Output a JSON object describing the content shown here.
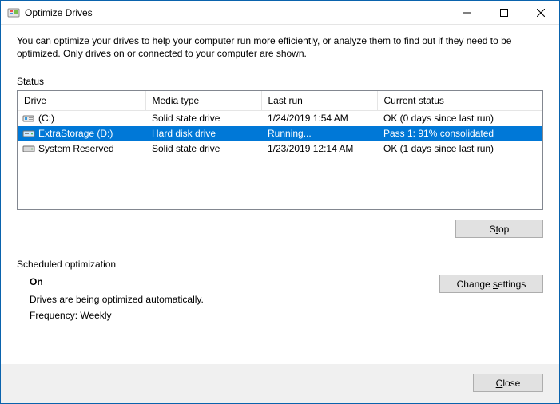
{
  "window": {
    "title": "Optimize Drives"
  },
  "intro": "You can optimize your drives to help your computer run more efficiently, or analyze them to find out if they need to be optimized. Only drives on or connected to your computer are shown.",
  "status_label": "Status",
  "columns": {
    "drive": "Drive",
    "media": "Media type",
    "last_run": "Last run",
    "current": "Current status"
  },
  "rows": [
    {
      "icon": "ssd",
      "name": " (C:)",
      "media": "Solid state drive",
      "last_run": "1/24/2019 1:54 AM",
      "status": "OK (0 days since last run)",
      "selected": false
    },
    {
      "icon": "hdd",
      "name": "ExtraStorage (D:)",
      "media": "Hard disk drive",
      "last_run": "Running...",
      "status": "Pass 1: 91% consolidated",
      "selected": true
    },
    {
      "icon": "hdd",
      "name": "System Reserved",
      "media": "Solid state drive",
      "last_run": "1/23/2019 12:14 AM",
      "status": "OK (1 days since last run)",
      "selected": false
    }
  ],
  "buttons": {
    "stop_pre": "S",
    "stop_u": "t",
    "stop_post": "op",
    "change_pre": "Change ",
    "change_u": "s",
    "change_post": "ettings",
    "close_pre": "",
    "close_u": "C",
    "close_post": "lose"
  },
  "sched": {
    "label": "Scheduled optimization",
    "on": "On",
    "desc": "Drives are being optimized automatically.",
    "freq": "Frequency: Weekly"
  }
}
